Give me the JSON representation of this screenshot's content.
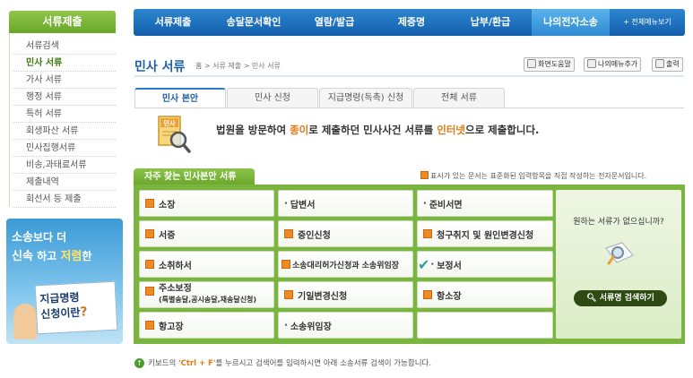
{
  "sidebar": {
    "header": "서류제출",
    "items": [
      {
        "label": "서류검색"
      },
      {
        "label": "민사 서류",
        "active": true
      },
      {
        "label": "가사 서류"
      },
      {
        "label": "행정 서류"
      },
      {
        "label": "특허 서류"
      },
      {
        "label": "회생파산 서류"
      },
      {
        "label": "민사집행서류"
      },
      {
        "label": "비송,과태료서류"
      },
      {
        "label": "제출내역"
      },
      {
        "label": "회선서 등 제출"
      }
    ],
    "promo": {
      "line1_a": "소송",
      "line1_b": "보다 더",
      "line2_a": "신속",
      "line2_b": "하고",
      "line2_c": "저렴",
      "line2_d": "한",
      "card_line1": "지급명령",
      "card_line2": "신청이란",
      "card_q": "?"
    }
  },
  "topnav": {
    "items": [
      "서류제출",
      "송달문서확인",
      "열람/발급",
      "제증명",
      "납부/환급",
      "나의전자소송",
      "+ 전체메뉴보기"
    ],
    "active_index": 5
  },
  "header": {
    "title": "민사 서류",
    "breadcrumb": "홈 > 서류 제출 > 민사 서류",
    "buttons": {
      "help": "화면도움말",
      "mymenu": "나의메뉴추가",
      "print": "출력"
    }
  },
  "tabs": [
    "민사 본안",
    "민사 신청",
    "지급명령(독촉) 신청",
    "전체 서류"
  ],
  "active_tab": 0,
  "intro": {
    "icon_label": "민사",
    "text_a": "법원을 방문하여 ",
    "text_hl1": "종이",
    "text_b": "로 제출하던 민사사건 서류를 ",
    "text_hl2": "인터넷",
    "text_c": "으로 제출합니다."
  },
  "freq": {
    "title": "자주 찾는 민사본안 서류",
    "note": "표시가 있는 문서는 표준화된 입력항목을 직접 작성하는 전자문서입니다.",
    "cells": [
      {
        "label": "소장",
        "marker": "square"
      },
      {
        "label": "답변서",
        "marker": "dot"
      },
      {
        "label": "준비서면",
        "marker": "dot"
      },
      {
        "label": "서증",
        "marker": "square"
      },
      {
        "label": "증인신청",
        "marker": "square"
      },
      {
        "label": "청구취지 및 원인변경신청",
        "marker": "square"
      },
      {
        "label": "소취하서",
        "marker": "square"
      },
      {
        "label": "소송대리허가신청과 소송위임장",
        "marker": "square"
      },
      {
        "label": "보정서",
        "marker": "dot"
      },
      {
        "label": "주소보정",
        "sub": "(특별송달,공시송달,재송달신청)",
        "marker": "square"
      },
      {
        "label": "기일변경신청",
        "marker": "square"
      },
      {
        "label": "항소장",
        "marker": "square"
      },
      {
        "label": "항고장",
        "marker": "square"
      },
      {
        "label": "소송위임장",
        "marker": "dot"
      },
      {
        "label": "",
        "marker": "none"
      }
    ]
  },
  "rightbox": {
    "question": "원하는 서류가 없으십니까?",
    "button": "서류명 검색하기"
  },
  "tip": {
    "pre": "키보드의 ",
    "key": "'Ctrl + F'",
    "post": "를 누르시고 검색어를 입력하시면 아래 소송서류 검색이 가능합니다."
  },
  "colors": {
    "nav": "#145fad",
    "green": "#7ab53f",
    "orange": "#ef8a21"
  }
}
